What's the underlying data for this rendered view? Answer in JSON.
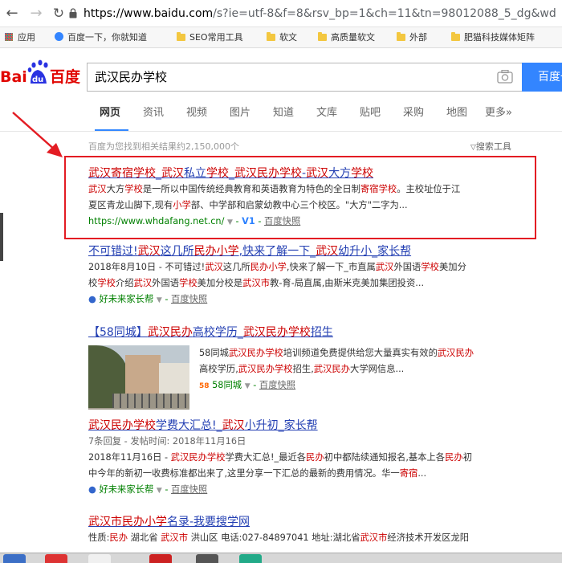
{
  "browser": {
    "url_host": "https://www.baidu.com",
    "url_path": "/s?ie=utf-8&f=8&rsv_bp=1&ch=11&tn=98012088_5_dg&wd"
  },
  "bookmarks": [
    {
      "label": "应用",
      "icon": "apps-grid-icon"
    },
    {
      "label": "百度一下，你就知道",
      "icon": "baidu-paw-icon"
    },
    {
      "label": "SEO常用工具",
      "icon": "folder-icon"
    },
    {
      "label": "软文",
      "icon": "folder-icon"
    },
    {
      "label": "高质量软文",
      "icon": "folder-icon"
    },
    {
      "label": "外部",
      "icon": "folder-icon"
    },
    {
      "label": "肥猫科技媒体矩阵",
      "icon": "folder-icon"
    }
  ],
  "search": {
    "query": "武汉民办学校",
    "button_label": "百度一"
  },
  "tabs": [
    "网页",
    "资讯",
    "视频",
    "图片",
    "知道",
    "文库",
    "贴吧",
    "采购",
    "地图",
    "更多»"
  ],
  "result_count_text": "百度为您找到相关结果约2,150,000个",
  "search_tools_label": "搜索工具",
  "results": [
    {
      "title": "武汉寄宿学校_武汉私立学校_武汉民办学校-武汉大方学校",
      "snippet1": "武汉大方学校是一所以中国传统经典教育和英语教育为特色的全日制寄宿学校。主校址位于江",
      "snippet2": "夏区青龙山脚下,现有小学部、中学部和启蒙幼教中心三个校区。\"大方\"二字为...",
      "site": "https://www.whdafang.net.cn/",
      "badge": "V1",
      "kuaizhao": "百度快照"
    },
    {
      "title": "不可错过!武汉这几所民办小学,快来了解一下_武汉幼升小_家长帮",
      "snippet1": "2018年8月10日 - 不可错过!武汉这几所民办小学,快来了解一下_市直属武汉外国语学校美加分",
      "snippet2": "校学校介绍武汉外国语学校美加分校是武汉市教-育-局直属,由斯米克美加集团投资...",
      "site": "好未来家长帮",
      "kuaizhao": "百度快照"
    },
    {
      "title": "【58同城】武汉民办高校学历_武汉民办学校招生",
      "snippet1": "58同城武汉民办学校培训频道免费提供给您大量真实有效的武汉民办",
      "snippet2": "高校学历,武汉民办学校招生,武汉民办大学网信息...",
      "site": "58同城",
      "kuaizhao": "百度快照"
    },
    {
      "title": "武汉民办学校学费大汇总!_武汉小升初_家长帮",
      "meta": "7条回复 - 发帖时间: 2018年11月16日",
      "snippet1": "2018年11月16日 - 武汉民办学校学费大汇总!_最近各民办初中都陆续通知报名,基本上各民办初",
      "snippet2": "中今年的新初一收费标准都出来了,这里分享一下汇总的最新的费用情况。华一寄宿...",
      "site": "好未来家长帮",
      "kuaizhao": "百度快照"
    },
    {
      "title": "武汉市民办小学名录-我要搜学网",
      "snippet1": "性质:民办 湖北省 武汉市 洪山区 电话:027-84897041 地址:湖北省武汉市经济技术开发区龙阳"
    }
  ]
}
